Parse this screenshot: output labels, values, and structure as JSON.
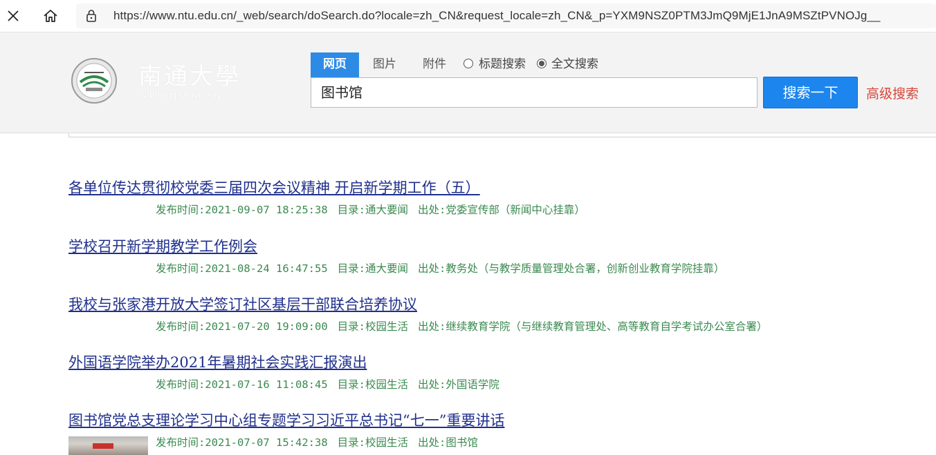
{
  "browser": {
    "url": "https://www.ntu.edu.cn/_web/search/doSearch.do?locale=zh_CN&request_locale=zh_CN&_p=YXM9NSZ0PTM3JmQ9MjE1JnA9MSZtPVNOJg__"
  },
  "header": {
    "logo_cn": "南通大學",
    "logo_en": "Nantong University",
    "tabs": [
      "网页",
      "图片",
      "附件"
    ],
    "radio_title": "标题搜索",
    "radio_fulltext": "全文搜索",
    "search_value": "图书馆",
    "search_button": "搜索一下",
    "advanced_link": "高级搜索"
  },
  "labels": {
    "time": "发布时间:",
    "category": "目录:",
    "source": "出处:"
  },
  "results": [
    {
      "title": "各单位传达贯彻校党委三届四次会议精神 开启新学期工作（五）",
      "time": "2021-09-07 18:25:38",
      "category": "通大要闻",
      "source": "党委宣传部（新闻中心挂靠）"
    },
    {
      "title": "学校召开新学期教学工作例会",
      "time": "2021-08-24 16:47:55",
      "category": "通大要闻",
      "source": "教务处（与教学质量管理处合署，创新创业教育学院挂靠）"
    },
    {
      "title": "我校与张家港开放大学签订社区基层干部联合培养协议",
      "time": "2021-07-20 19:09:00",
      "category": "校园生活",
      "source": "继续教育学院（与继续教育管理处、高等教育自学考试办公室合署）"
    },
    {
      "title": "外国语学院举办2021年暑期社会实践汇报演出",
      "time": "2021-07-16 11:08:45",
      "category": "校园生活",
      "source": "外国语学院"
    },
    {
      "title": "图书馆党总支理论学习中心组专题学习习近平总书记“七一”重要讲话",
      "time": "2021-07-07 15:42:38",
      "category": "校园生活",
      "source": "图书馆"
    }
  ]
}
